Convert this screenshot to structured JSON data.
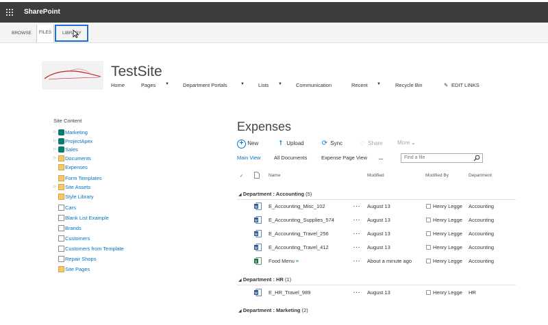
{
  "suite": {
    "brand": "SharePoint"
  },
  "ribbon": {
    "tabs": [
      "BROWSE",
      "FILES",
      "LIBRARY"
    ]
  },
  "header": {
    "site_title": "TestSite",
    "nav": [
      {
        "label": "Home",
        "dropdown": false
      },
      {
        "label": "Pages",
        "dropdown": true
      },
      {
        "label": "Department Portals",
        "dropdown": true
      },
      {
        "label": "Lists",
        "dropdown": true
      },
      {
        "label": "Communication",
        "dropdown": false
      },
      {
        "label": "Recent",
        "dropdown": true
      },
      {
        "label": "Recycle Bin",
        "dropdown": false
      }
    ],
    "edit_links": "EDIT LINKS"
  },
  "leftnav": {
    "heading": "Site Content",
    "items": [
      {
        "label": "Marketing",
        "icon": "site-icon",
        "expandable": true
      },
      {
        "label": "ProjectApex",
        "icon": "site-icon",
        "expandable": true
      },
      {
        "label": "Sales",
        "icon": "site-icon",
        "expandable": true
      },
      {
        "label": "Documents",
        "icon": "library-icon",
        "expandable": true
      },
      {
        "label": "Expenses",
        "icon": "library-icon",
        "expandable": false
      },
      {
        "label": "Form Templates",
        "icon": "library-icon",
        "expandable": false
      },
      {
        "label": "Site Assets",
        "icon": "library-icon",
        "expandable": true
      },
      {
        "label": "Style Library",
        "icon": "library-icon",
        "expandable": false
      },
      {
        "label": "Cars",
        "icon": "picture-library-icon",
        "expandable": false
      },
      {
        "label": "Blank List Example",
        "icon": "list-icon",
        "expandable": false
      },
      {
        "label": "Brands",
        "icon": "list-icon",
        "expandable": false
      },
      {
        "label": "Customers",
        "icon": "list-icon",
        "expandable": false
      },
      {
        "label": "Customers from Template",
        "icon": "list-icon",
        "expandable": false
      },
      {
        "label": "Repair Shops",
        "icon": "list-icon",
        "expandable": false
      },
      {
        "label": "Site Pages",
        "icon": "library-icon",
        "expandable": false
      }
    ]
  },
  "main": {
    "title": "Expenses",
    "commands": [
      "New",
      "Upload",
      "Sync",
      "Share",
      "More"
    ],
    "views": [
      "Main View",
      "All Documents",
      "Expense Page View",
      "..."
    ],
    "search_placeholder": "Find a file",
    "columns": [
      "Name",
      "Modified",
      "Modified By",
      "Department"
    ],
    "groups": [
      {
        "label": "Department : Accounting",
        "count": "(5)",
        "rows": [
          {
            "name": "E_Accounting_Misc_102",
            "type": "word",
            "modified": "August 13",
            "modified_by": "Henry Legge",
            "department": "Accounting"
          },
          {
            "name": "E_Accounting_Supplies_574",
            "type": "word",
            "modified": "August 13",
            "modified_by": "Henry Legge",
            "department": "Accounting"
          },
          {
            "name": "E_Accounting_Travel_256",
            "type": "word",
            "modified": "August 13",
            "modified_by": "Henry Legge",
            "department": "Accounting"
          },
          {
            "name": "E_Accounting_Travel_412",
            "type": "word",
            "modified": "August 13",
            "modified_by": "Henry Legge",
            "department": "Accounting"
          },
          {
            "name": "Food Menu",
            "type": "excel",
            "modified": "About a minute ago",
            "modified_by": "Henry Legge",
            "department": "Accounting",
            "new_mark": "¤"
          }
        ]
      },
      {
        "label": "Department : HR",
        "count": "(1)",
        "rows": [
          {
            "name": "E_HR_Travel_989",
            "type": "word",
            "modified": "August 13",
            "modified_by": "Henry Legge",
            "department": "HR"
          }
        ]
      },
      {
        "label": "Department : Marketing",
        "count": "(2)",
        "rows": []
      }
    ]
  },
  "colors": {
    "suitebar": "#3c3c3c",
    "accent": "#0072c6",
    "highlight_box": "#1f6fd1",
    "excel": "#217346",
    "word": "#2b579a"
  }
}
